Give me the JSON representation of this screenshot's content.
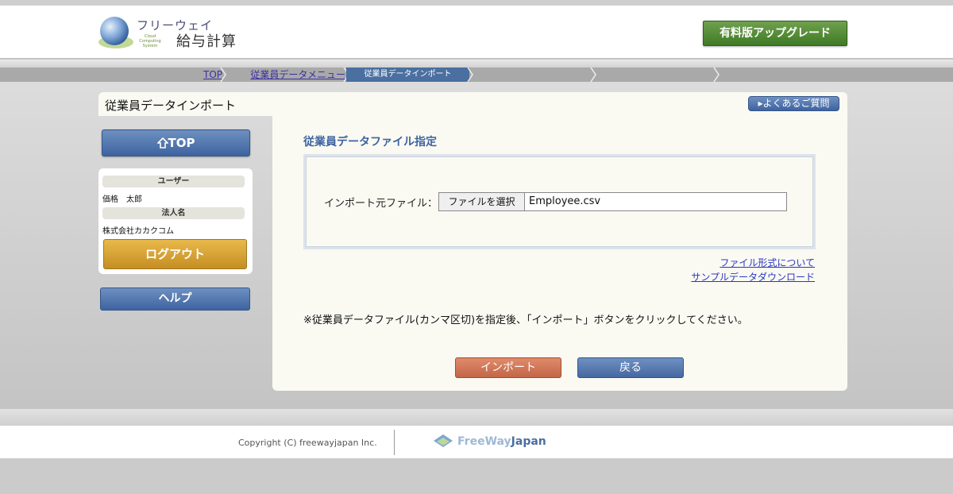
{
  "header": {
    "logo_top": "フリーウェイ",
    "logo_sub": "Cloud Computing System",
    "logo_main": "給与計算",
    "upgrade_label": "有料版アップグレード"
  },
  "breadcrumb": {
    "items": [
      {
        "label": "TOP"
      },
      {
        "label": "従業員データメニュー"
      },
      {
        "label": "従業員データインポート"
      }
    ]
  },
  "page_title": "従業員データインポート",
  "faq_label": "▸よくあるご質問",
  "sidebar": {
    "top_label": "TOP",
    "user_label": "ユーザー",
    "user_name": "価格　太郎",
    "corp_label": "法人名",
    "corp_name": "株式会社カカクコム",
    "logout_label": "ログアウト",
    "help_label": "ヘルプ"
  },
  "main": {
    "section_heading": "従業員データファイル指定",
    "file_label": "インポート元ファイル：",
    "choose_file_label": "ファイルを選択",
    "file_name": "Employee.csv",
    "link_format": "ファイル形式について",
    "link_sample": "サンプルデータダウンロード",
    "note": "※従業員データファイル(カンマ区切)を指定後、「インポート」ボタンをクリックしてください。",
    "import_label": "インポート",
    "back_label": "戻る"
  },
  "footer": {
    "copyright": "Copyright (C) freewayjapan Inc.",
    "brand_part1": "FreeWay",
    "brand_part2": "Japan"
  },
  "colors": {
    "accent_blue": "#3e63a0",
    "upgrade_green": "#4f8a32",
    "logout_gold": "#d9a534",
    "import_orange": "#d0785a"
  }
}
